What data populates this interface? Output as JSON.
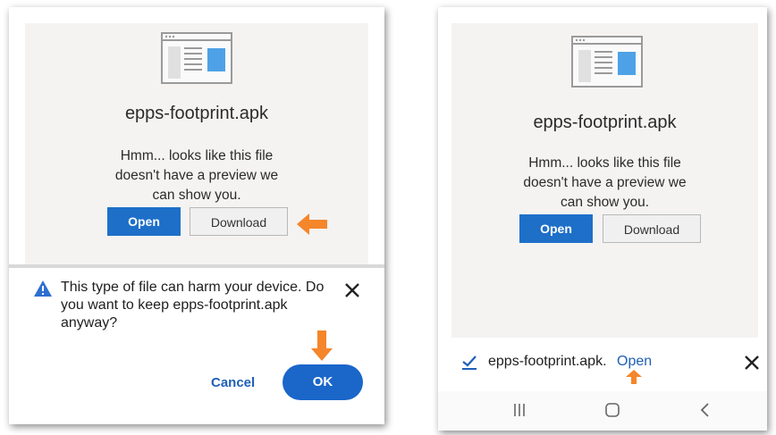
{
  "left_screen": {
    "file_name": "epps-footprint.apk",
    "preview_message_line1": "Hmm... looks like this file",
    "preview_message_line2": "doesn't have a preview we",
    "preview_message_line3": "can show you.",
    "open_label": "Open",
    "download_label": "Download",
    "warning_text": "This type of file can harm your device. Do you want to keep epps-footprint.apk anyway?",
    "cancel_label": "Cancel",
    "ok_label": "OK"
  },
  "right_screen": {
    "file_name": "epps-footprint.apk",
    "preview_message_line1": "Hmm... looks like this file",
    "preview_message_line2": "doesn't have a preview we",
    "preview_message_line3": "can show you.",
    "open_label": "Open",
    "download_label": "Download",
    "downloaded_filename": "epps-footprint.apk.",
    "downloaded_open_label": "Open"
  },
  "colors": {
    "primary_blue": "#1e6fc8",
    "link_blue": "#1e5fb8",
    "highlight_arrow": "#f5862a",
    "warning_blue": "#2f6fd1"
  },
  "icons": [
    "file-preview-icon",
    "warning-icon",
    "close-icon",
    "check-download-icon",
    "arrow-pointer-icon",
    "nav-recent-apps-icon",
    "nav-home-icon",
    "nav-back-icon"
  ]
}
